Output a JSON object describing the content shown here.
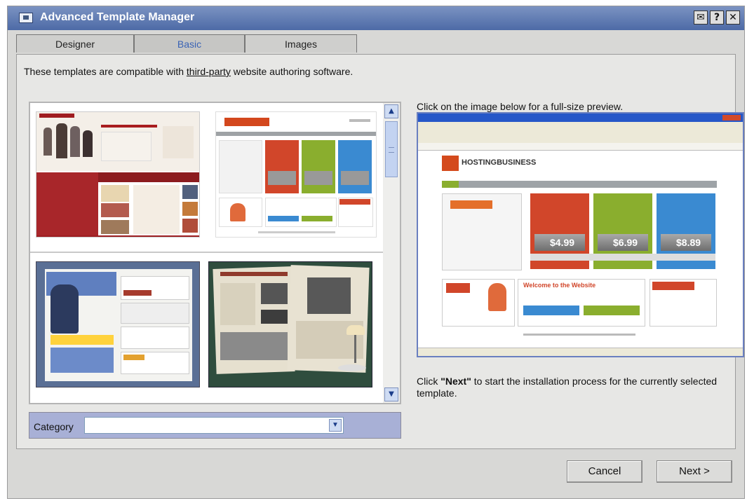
{
  "window": {
    "title": "Advanced Template Manager"
  },
  "titlebar_buttons": [
    {
      "icon": "envelope-icon",
      "glyph": "✉"
    },
    {
      "icon": "help-icon",
      "glyph": "?"
    },
    {
      "icon": "close-icon",
      "glyph": "✕"
    }
  ],
  "tabs": [
    {
      "label": "Designer",
      "active": false
    },
    {
      "label": "Basic",
      "active": true
    },
    {
      "label": "Images",
      "active": false
    }
  ],
  "intro": {
    "before": "These templates are compatible with ",
    "link": "third-party",
    "after": " website authoring software."
  },
  "category": {
    "label": "Category",
    "value": ""
  },
  "preview": {
    "caption": "Click on the image below for a full-size preview.",
    "brand": "HOSTINGBUSINESS",
    "prices": [
      "$4.99",
      "$6.99",
      "$8.89"
    ],
    "welcome": "Welcome to the Website"
  },
  "next_note": {
    "before": "Click ",
    "strong": "\"Next\"",
    "after": " to start the installation process for the currently selected template."
  },
  "buttons": {
    "cancel": "Cancel",
    "next": "Next >"
  },
  "colors": {
    "titlebar": "#5a74ad",
    "accent_red": "#d1462a",
    "accent_green": "#8aae2e",
    "accent_blue": "#3a8ad1"
  }
}
